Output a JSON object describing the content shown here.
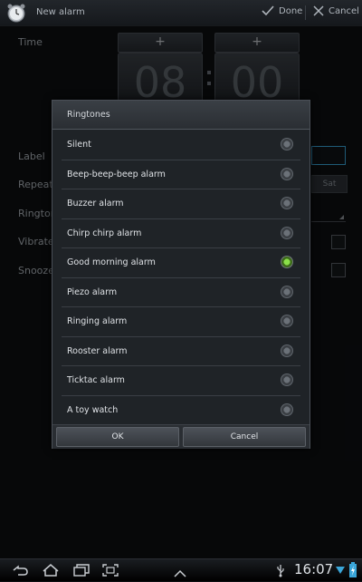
{
  "actionbar": {
    "title": "New alarm",
    "done_label": "Done",
    "cancel_label": "Cancel"
  },
  "form": {
    "time_label": "Time",
    "hour_plus": "+",
    "minute_plus": "+",
    "hour_value": "08",
    "minute_value": "00",
    "label_label": "Label",
    "repeat_label": "Repeat",
    "ringtone_label": "Rington",
    "vibrate_label": "Vibrate",
    "snooze_label": "Snooze",
    "sat_label": "Sat"
  },
  "dialog": {
    "title": "Ringtones",
    "items": [
      {
        "label": "Silent",
        "selected": false
      },
      {
        "label": "Beep-beep-beep alarm",
        "selected": false
      },
      {
        "label": "Buzzer alarm",
        "selected": false
      },
      {
        "label": "Chirp chirp alarm",
        "selected": false
      },
      {
        "label": "Good morning alarm",
        "selected": true
      },
      {
        "label": "Piezo alarm",
        "selected": false
      },
      {
        "label": "Ringing alarm",
        "selected": false
      },
      {
        "label": "Rooster alarm",
        "selected": false
      },
      {
        "label": "Ticktac alarm",
        "selected": false
      },
      {
        "label": "A toy watch",
        "selected": false
      }
    ],
    "ok_label": "OK",
    "cancel_label": "Cancel"
  },
  "sysbar": {
    "time": "16:07"
  },
  "colors": {
    "accent_selected": "#8be04a",
    "focus_blue": "#3aa6d9"
  }
}
